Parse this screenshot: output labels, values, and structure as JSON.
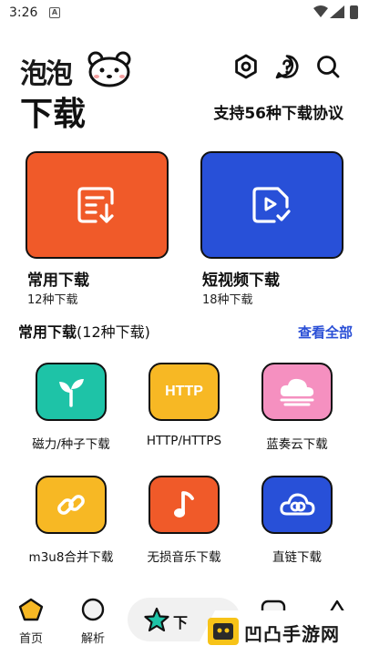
{
  "status": {
    "time": "3:26",
    "notif_glyph": "A"
  },
  "header": {
    "logo_text": "泡泡",
    "title": "下载",
    "protocol_text": "支持56种下载协议",
    "icons": [
      "settings-icon",
      "help-icon",
      "search-icon"
    ]
  },
  "cards": [
    {
      "title": "常用下载",
      "sub": "12种下载",
      "color": "#f05a29",
      "icon": "document-download-icon"
    },
    {
      "title": "短视频下载",
      "sub": "18种下载",
      "color": "#2850d8",
      "icon": "video-file-icon"
    }
  ],
  "section": {
    "title_main": "常用下载",
    "title_count": "(12种下载)",
    "see_all": "查看全部"
  },
  "grid": [
    {
      "label": "磁力/种子下载",
      "color": "#1ec3a7",
      "icon": "sprout-icon"
    },
    {
      "label": "HTTP/HTTPS",
      "color": "#f7b824",
      "icon": "http-icon",
      "icon_text": "HTTP"
    },
    {
      "label": "蓝奏云下载",
      "color": "#f590c0",
      "icon": "cloud-icon"
    },
    {
      "label": "m3u8合并下载",
      "color": "#f7b824",
      "icon": "link-icon"
    },
    {
      "label": "无损音乐下载",
      "color": "#f05a29",
      "icon": "music-note-icon"
    },
    {
      "label": "直链下载",
      "color": "#2850d8",
      "icon": "cloud-link-icon"
    }
  ],
  "nav": [
    {
      "label": "首页",
      "icon": "pentagon-icon"
    },
    {
      "label": "解析",
      "icon": "circle-icon"
    },
    {
      "label": "下",
      "icon": "star-icon"
    }
  ],
  "watermark": {
    "text": "凹凸手游网"
  }
}
